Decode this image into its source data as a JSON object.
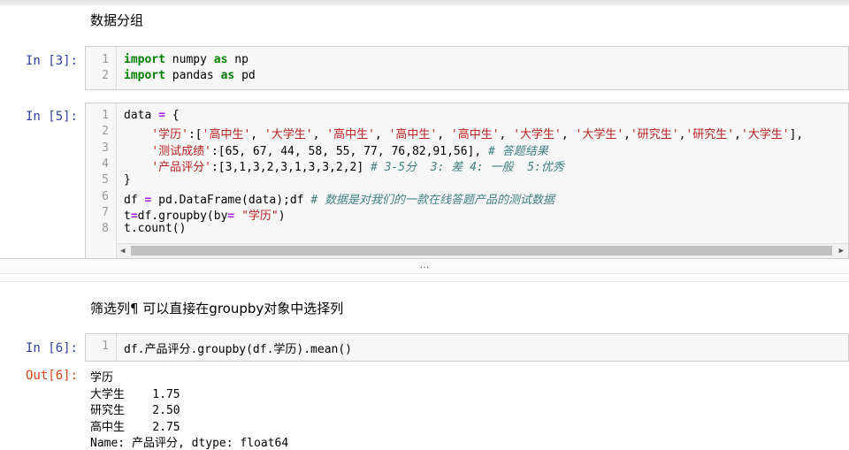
{
  "cells": {
    "md1": {
      "text": "数据分组"
    },
    "cell3": {
      "prompt": "In  [3]:",
      "line_numbers": [
        "1",
        "2"
      ],
      "lines": [
        [
          {
            "t": "import",
            "c": "kw"
          },
          {
            "t": " numpy ",
            "c": ""
          },
          {
            "t": "as",
            "c": "kw"
          },
          {
            "t": " np",
            "c": ""
          }
        ],
        [
          {
            "t": "import",
            "c": "kw"
          },
          {
            "t": " pandas ",
            "c": ""
          },
          {
            "t": "as",
            "c": "kw"
          },
          {
            "t": " pd",
            "c": ""
          }
        ]
      ]
    },
    "cell5": {
      "prompt": "In  [5]:",
      "line_numbers": [
        "1",
        "2",
        "3",
        "4",
        "5",
        "6",
        "7",
        "8"
      ],
      "lines": [
        [
          {
            "t": "data ",
            "c": ""
          },
          {
            "t": "=",
            "c": "op"
          },
          {
            "t": " {",
            "c": ""
          }
        ],
        [
          {
            "t": "    ",
            "c": ""
          },
          {
            "t": "'学历'",
            "c": "str"
          },
          {
            "t": ":[",
            "c": ""
          },
          {
            "t": "'高中生'",
            "c": "str"
          },
          {
            "t": ", ",
            "c": ""
          },
          {
            "t": "'大学生'",
            "c": "str"
          },
          {
            "t": ", ",
            "c": ""
          },
          {
            "t": "'高中生'",
            "c": "str"
          },
          {
            "t": ", ",
            "c": ""
          },
          {
            "t": "'高中生'",
            "c": "str"
          },
          {
            "t": ", ",
            "c": ""
          },
          {
            "t": "'高中生'",
            "c": "str"
          },
          {
            "t": ", ",
            "c": ""
          },
          {
            "t": "'大学生'",
            "c": "str"
          },
          {
            "t": ", ",
            "c": ""
          },
          {
            "t": "'大学生'",
            "c": "str"
          },
          {
            "t": ",",
            "c": ""
          },
          {
            "t": "'研究生'",
            "c": "str"
          },
          {
            "t": ",",
            "c": ""
          },
          {
            "t": "'研究生'",
            "c": "str"
          },
          {
            "t": ",",
            "c": ""
          },
          {
            "t": "'大学生'",
            "c": "str"
          },
          {
            "t": "],",
            "c": ""
          }
        ],
        [
          {
            "t": "    ",
            "c": ""
          },
          {
            "t": "'测试成绩'",
            "c": "str"
          },
          {
            "t": ":[65, 67, 44, 58, 55, 77, 76,82,91,56], ",
            "c": ""
          },
          {
            "t": "# 答题结果",
            "c": "com"
          }
        ],
        [
          {
            "t": "    ",
            "c": ""
          },
          {
            "t": "'产品评分'",
            "c": "str"
          },
          {
            "t": ":[3,1,3,2,3,1,3,3,2,2] ",
            "c": ""
          },
          {
            "t": "# 3-5分  3: 差 4: 一般  5:优秀",
            "c": "com"
          }
        ],
        [
          {
            "t": "}",
            "c": ""
          }
        ],
        [
          {
            "t": "df ",
            "c": ""
          },
          {
            "t": "=",
            "c": "op"
          },
          {
            "t": " pd.DataFrame(data);df ",
            "c": ""
          },
          {
            "t": "# 数据是对我们的一款在线答题产品的测试数据",
            "c": "com"
          }
        ],
        [
          {
            "t": "t",
            "c": ""
          },
          {
            "t": "=",
            "c": "op"
          },
          {
            "t": "df.groupby(by",
            "c": ""
          },
          {
            "t": "=",
            "c": "op"
          },
          {
            "t": " ",
            "c": ""
          },
          {
            "t": "\"学历\"",
            "c": "str"
          },
          {
            "t": ")",
            "c": ""
          }
        ],
        [
          {
            "t": "t.count()",
            "c": ""
          }
        ]
      ]
    },
    "collapse": {
      "text": "..."
    },
    "md2": {
      "text": "筛选列¶ 可以直接在groupby对象中选择列"
    },
    "cell6": {
      "prompt": "In  [6]:",
      "line_numbers": [
        "1"
      ],
      "lines": [
        [
          {
            "t": "df.产品评分.groupby(df.学历).mean()",
            "c": ""
          }
        ]
      ],
      "out_prompt": "Out[6]:",
      "output_lines": [
        "学历",
        "大学生    1.75",
        "研究生    2.50",
        "高中生    2.75",
        "Name: 产品评分, dtype: float64"
      ]
    }
  }
}
